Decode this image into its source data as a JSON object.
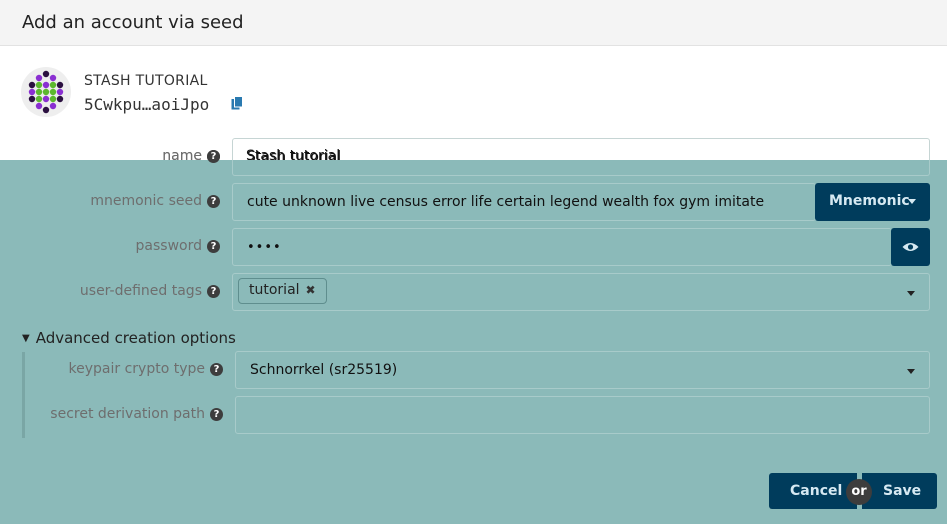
{
  "modal": {
    "title": "Add an account via seed"
  },
  "account": {
    "name": "STASH TUTORIAL",
    "address": "5Cwkpu…aoiJpo"
  },
  "fields": {
    "name": {
      "label": "name",
      "value": "Stash tutorial"
    },
    "mnemonic": {
      "label": "mnemonic seed",
      "value": "cute unknown live census error life certain legend wealth fox gym imitate",
      "type_label": "Mnemonic"
    },
    "password": {
      "label": "password",
      "value": "••••"
    },
    "tags": {
      "label": "user-defined tags",
      "items": [
        "tutorial"
      ]
    }
  },
  "advanced": {
    "toggle_label": "Advanced creation options",
    "crypto_type": {
      "label": "keypair crypto type",
      "value": "Schnorrkel (sr25519)"
    },
    "derivation": {
      "label": "secret derivation path",
      "value": ""
    }
  },
  "actions": {
    "cancel": "Cancel",
    "or": "or",
    "save": "Save"
  },
  "colors": {
    "overlay": "#8bbab9",
    "button": "#003c5c",
    "button_text": "#d6e9f2"
  },
  "icons": [
    "identicon",
    "copy-icon",
    "help-icon",
    "chevron-down-icon",
    "eye-icon",
    "remove-tag-icon",
    "caret-down-icon"
  ]
}
